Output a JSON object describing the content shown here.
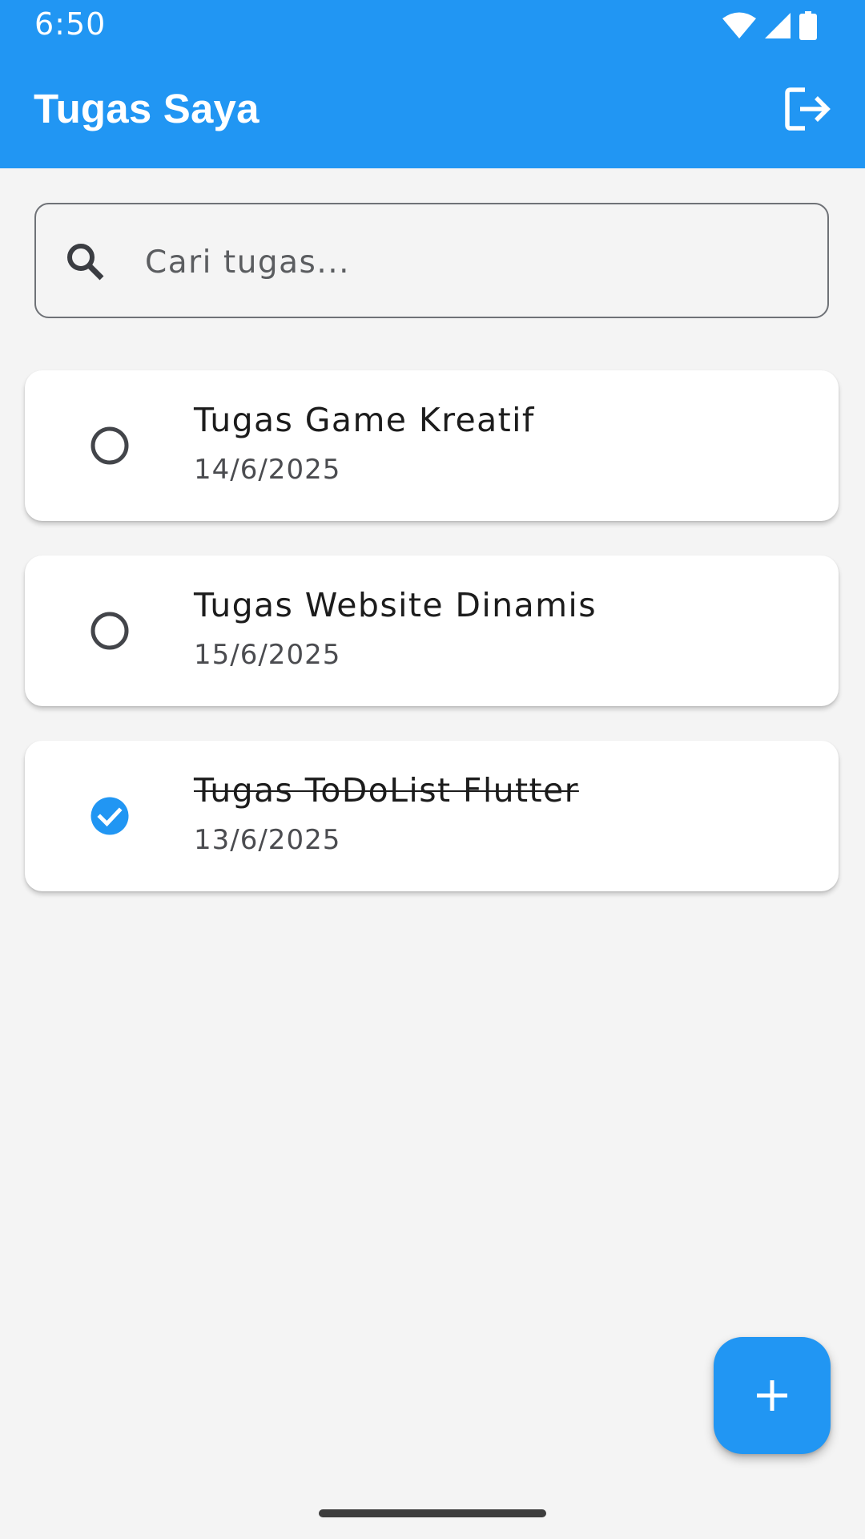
{
  "status_bar": {
    "time": "6:50",
    "icons": [
      "wifi-icon",
      "cellular-signal-icon",
      "battery-icon"
    ]
  },
  "app_bar": {
    "title": "Tugas Saya",
    "action_icon": "logout-icon"
  },
  "search": {
    "icon": "search-icon",
    "placeholder": "Cari tugas...",
    "value": ""
  },
  "tasks": [
    {
      "title": "Tugas Game Kreatif",
      "date": "14/6/2025",
      "completed": false
    },
    {
      "title": "Tugas Website Dinamis",
      "date": "15/6/2025",
      "completed": false
    },
    {
      "title": "Tugas ToDoList Flutter",
      "date": "13/6/2025",
      "completed": true
    }
  ],
  "fab": {
    "icon": "plus-icon"
  },
  "colors": {
    "primary": "#2196F3",
    "background": "#F4F4F4",
    "card": "#FFFFFF",
    "text_primary": "#1C1C1C",
    "text_secondary": "#4B4C50"
  }
}
